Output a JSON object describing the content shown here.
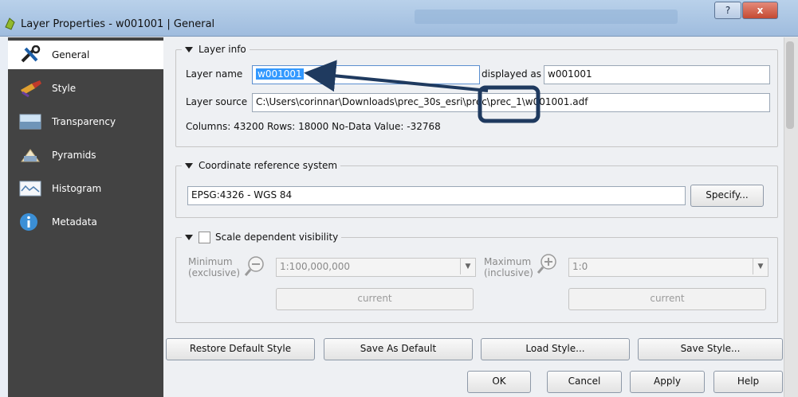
{
  "window": {
    "title": "Layer Properties - w001001 | General",
    "help_label": "?",
    "close_label": "x"
  },
  "sidebar": {
    "items": [
      {
        "label": "General",
        "icon": "tools-icon",
        "active": true
      },
      {
        "label": "Style",
        "icon": "style-brush-icon"
      },
      {
        "label": "Transparency",
        "icon": "transparency-icon"
      },
      {
        "label": "Pyramids",
        "icon": "pyramids-icon"
      },
      {
        "label": "Histogram",
        "icon": "histogram-icon"
      },
      {
        "label": "Metadata",
        "icon": "info-icon"
      }
    ]
  },
  "layer_info": {
    "legend": "Layer info",
    "name_label": "Layer name",
    "name_value": "w001001",
    "displayed_as_label": "displayed as",
    "displayed_as_value": "w001001",
    "source_label": "Layer source",
    "source_value": "C:\\Users\\corinnar\\Downloads\\prec_30s_esri\\prec\\prec_1\\w001001.adf",
    "stats": "Columns: 43200  Rows: 18000  No-Data Value: -32768"
  },
  "crs": {
    "legend": "Coordinate reference system",
    "value": "EPSG:4326 - WGS 84",
    "specify_label": "Specify..."
  },
  "scale": {
    "legend": "Scale dependent visibility",
    "min_label_1": "Minimum",
    "min_label_2": "(exclusive)",
    "min_value": "1:100,000,000",
    "max_label_1": "Maximum",
    "max_label_2": "(inclusive)",
    "max_value": "1:0",
    "current_label": "current"
  },
  "style_buttons": {
    "restore": "Restore Default Style",
    "save_default": "Save As Default",
    "load": "Load Style...",
    "save": "Save Style..."
  },
  "dialog_buttons": {
    "ok": "OK",
    "cancel": "Cancel",
    "apply": "Apply",
    "help": "Help"
  },
  "colors": {
    "sidebar": "#434343",
    "annotation": "#1f3a5f",
    "selection": "#3399ff"
  }
}
